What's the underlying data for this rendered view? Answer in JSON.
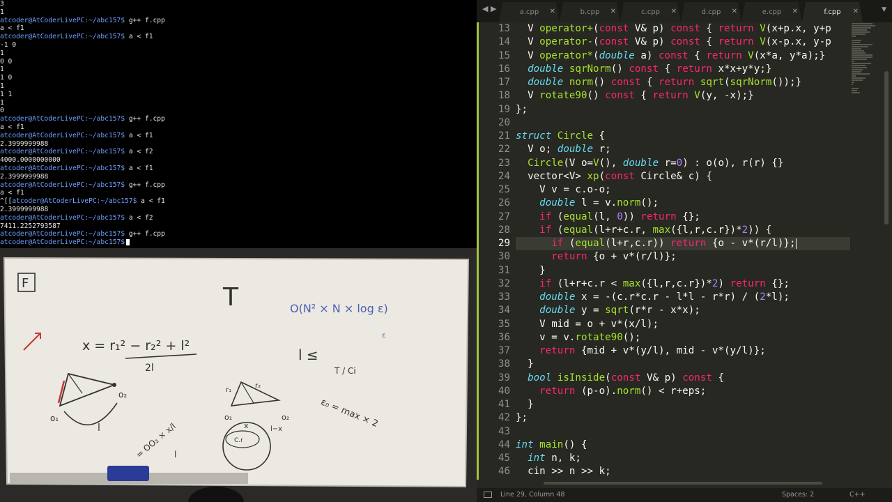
{
  "terminal": {
    "lines": [
      {
        "text": "3"
      },
      {
        "text": "1"
      },
      {
        "prompt": "atcoder@AtCoderLivePC:~/abc157$",
        "cmd": " g++ f.cpp"
      },
      {
        "text": "a < f1"
      },
      {
        "prompt": "atcoder@AtCoderLivePC:~/abc157$",
        "cmd": " a < f1"
      },
      {
        "text": "-1 0"
      },
      {
        "text": "1"
      },
      {
        "text": "0 0"
      },
      {
        "text": "1"
      },
      {
        "text": "1 0"
      },
      {
        "text": "1"
      },
      {
        "text": "1 1"
      },
      {
        "text": "1"
      },
      {
        "text": "0"
      },
      {
        "prompt": "atcoder@AtCoderLivePC:~/abc157$",
        "cmd": " g++ f.cpp"
      },
      {
        "text": "a < f1"
      },
      {
        "prompt": "atcoder@AtCoderLivePC:~/abc157$",
        "cmd": " a < f1"
      },
      {
        "text": "2.3999999988"
      },
      {
        "prompt": "atcoder@AtCoderLivePC:~/abc157$",
        "cmd": " a < f2"
      },
      {
        "text": "4000.0000000000"
      },
      {
        "prompt": "atcoder@AtCoderLivePC:~/abc157$",
        "cmd": " a < f1"
      },
      {
        "text": "2.3999999988"
      },
      {
        "prompt": "atcoder@AtCoderLivePC:~/abc157$",
        "cmd": " g++ f.cpp"
      },
      {
        "text": "a < f1"
      },
      {
        "prefix": "^[[",
        "prompt": "atcoder@AtCoderLivePC:~/abc157$",
        "cmd": " a < f1"
      },
      {
        "text": "2.3999999988"
      },
      {
        "prompt": "atcoder@AtCoderLivePC:~/abc157$",
        "cmd": " a < f2"
      },
      {
        "text": "7411.2252793587"
      },
      {
        "prompt": "atcoder@AtCoderLivePC:~/abc157$",
        "cmd": " g++ f.cpp"
      },
      {
        "prompt": "atcoder@AtCoderLivePC:~/abc157$",
        "cmd": "",
        "cursor": true
      }
    ]
  },
  "whiteboard": {
    "problem_label": "F",
    "t_label": "T",
    "complexity": "O(N² × N × log ε)",
    "formula_x": "x = r₁² − r₂² + l²",
    "formula_den": "2l",
    "inequality_l": "l ≤",
    "inequality_frac": "T / Ci",
    "eps_note": "ε",
    "label_o1": "o₁",
    "label_o2": "o₂",
    "label_l": "l",
    "label_r1": "r₁",
    "label_r2": "r₂",
    "label_x": "x",
    "label_lx": "l−x",
    "vec_note": "= OO₂ × x/l",
    "vec_note2": "l",
    "bin_note": "ε₀ = max × 2",
    "circle_label": "C.r"
  },
  "editor": {
    "nav": "◀ ▶",
    "tabs": [
      {
        "label": "a.cpp",
        "close": "✕",
        "active": false
      },
      {
        "label": "b.cpp",
        "close": "✕",
        "active": false
      },
      {
        "label": "c.cpp",
        "close": "✕",
        "active": false
      },
      {
        "label": "d.cpp",
        "close": "✕",
        "active": false
      },
      {
        "label": "e.cpp",
        "close": "✕",
        "active": false
      },
      {
        "label": "f.cpp",
        "close": "✕",
        "active": true
      }
    ],
    "overflow": "▼",
    "current_line": 29,
    "lines": [
      {
        "num": "13",
        "tokens": [
          [
            "  V ",
            ""
          ],
          [
            "operator+",
            "f"
          ],
          [
            "(",
            ""
          ],
          [
            "const",
            "k"
          ],
          [
            " V& p) ",
            ""
          ],
          [
            "const",
            "k"
          ],
          [
            " { ",
            ""
          ],
          [
            "return",
            "k"
          ],
          [
            " ",
            ""
          ],
          [
            "V",
            "f"
          ],
          [
            "(x+p.x, y+p",
            ""
          ]
        ]
      },
      {
        "num": "14",
        "tokens": [
          [
            "  V ",
            ""
          ],
          [
            "operator-",
            "f"
          ],
          [
            "(",
            ""
          ],
          [
            "const",
            "k"
          ],
          [
            " V& p) ",
            ""
          ],
          [
            "const",
            "k"
          ],
          [
            " { ",
            ""
          ],
          [
            "return",
            "k"
          ],
          [
            " ",
            ""
          ],
          [
            "V",
            "f"
          ],
          [
            "(x-p.x, y-p",
            ""
          ]
        ]
      },
      {
        "num": "15",
        "tokens": [
          [
            "  V ",
            ""
          ],
          [
            "operator*",
            "f"
          ],
          [
            "(",
            ""
          ],
          [
            "double",
            "t"
          ],
          [
            " a) ",
            ""
          ],
          [
            "const",
            "k"
          ],
          [
            " { ",
            ""
          ],
          [
            "return",
            "k"
          ],
          [
            " ",
            ""
          ],
          [
            "V",
            "f"
          ],
          [
            "(x*a, y*a);}",
            ""
          ]
        ]
      },
      {
        "num": "16",
        "tokens": [
          [
            "  ",
            ""
          ],
          [
            "double",
            "t"
          ],
          [
            " ",
            ""
          ],
          [
            "sqrNorm",
            "f"
          ],
          [
            "() ",
            ""
          ],
          [
            "const",
            "k"
          ],
          [
            " { ",
            ""
          ],
          [
            "return",
            "k"
          ],
          [
            " x*x+y*y;}",
            ""
          ]
        ]
      },
      {
        "num": "17",
        "tokens": [
          [
            "  ",
            ""
          ],
          [
            "double",
            "t"
          ],
          [
            " ",
            ""
          ],
          [
            "norm",
            "f"
          ],
          [
            "() ",
            ""
          ],
          [
            "const",
            "k"
          ],
          [
            " { ",
            ""
          ],
          [
            "return",
            "k"
          ],
          [
            " ",
            ""
          ],
          [
            "sqrt",
            "f"
          ],
          [
            "(",
            ""
          ],
          [
            "sqrNorm",
            "f"
          ],
          [
            "());}",
            ""
          ]
        ]
      },
      {
        "num": "18",
        "tokens": [
          [
            "  V ",
            ""
          ],
          [
            "rotate90",
            "f"
          ],
          [
            "() ",
            ""
          ],
          [
            "const",
            "k"
          ],
          [
            " { ",
            ""
          ],
          [
            "return",
            "k"
          ],
          [
            " ",
            ""
          ],
          [
            "V",
            "f"
          ],
          [
            "(y, -x);}",
            ""
          ]
        ]
      },
      {
        "num": "19",
        "tokens": [
          [
            "};",
            ""
          ]
        ]
      },
      {
        "num": "20",
        "tokens": [
          [
            "",
            ""
          ]
        ]
      },
      {
        "num": "21",
        "tokens": [
          [
            "struct",
            "t"
          ],
          [
            " ",
            ""
          ],
          [
            "Circle",
            "f"
          ],
          [
            " {",
            ""
          ]
        ]
      },
      {
        "num": "22",
        "tokens": [
          [
            "  V o; ",
            ""
          ],
          [
            "double",
            "t"
          ],
          [
            " r;",
            ""
          ]
        ]
      },
      {
        "num": "23",
        "tokens": [
          [
            "  ",
            ""
          ],
          [
            "Circle",
            "f"
          ],
          [
            "(V o=",
            ""
          ],
          [
            "V",
            "f"
          ],
          [
            "(), ",
            ""
          ],
          [
            "double",
            "t"
          ],
          [
            " r=",
            ""
          ],
          [
            "0",
            "n"
          ],
          [
            ") : o(o), r(r) {}",
            ""
          ]
        ]
      },
      {
        "num": "24",
        "tokens": [
          [
            "  vector<V> ",
            ""
          ],
          [
            "xp",
            "f"
          ],
          [
            "(",
            ""
          ],
          [
            "const",
            "k"
          ],
          [
            " Circle& c) {",
            ""
          ]
        ]
      },
      {
        "num": "25",
        "tokens": [
          [
            "    V v = c.o-o;",
            ""
          ]
        ]
      },
      {
        "num": "26",
        "tokens": [
          [
            "    ",
            ""
          ],
          [
            "double",
            "t"
          ],
          [
            " l = v.",
            ""
          ],
          [
            "norm",
            "f"
          ],
          [
            "();",
            ""
          ]
        ]
      },
      {
        "num": "27",
        "tokens": [
          [
            "    ",
            ""
          ],
          [
            "if",
            "k"
          ],
          [
            " (",
            ""
          ],
          [
            "equal",
            "f"
          ],
          [
            "(l, ",
            ""
          ],
          [
            "0",
            "n"
          ],
          [
            ")) ",
            ""
          ],
          [
            "return",
            "k"
          ],
          [
            " {};",
            ""
          ]
        ]
      },
      {
        "num": "28",
        "tokens": [
          [
            "    ",
            ""
          ],
          [
            "if",
            "k"
          ],
          [
            " (",
            ""
          ],
          [
            "equal",
            "f"
          ],
          [
            "(l+r+c.r, ",
            ""
          ],
          [
            "max",
            "f"
          ],
          [
            "({l,r,c.r})*",
            ""
          ],
          [
            "2",
            "n"
          ],
          [
            ")) {",
            ""
          ]
        ]
      },
      {
        "num": "29",
        "tokens": [
          [
            "      ",
            ""
          ],
          [
            "if",
            "k"
          ],
          [
            " (",
            ""
          ],
          [
            "equal",
            "f"
          ],
          [
            "(l+r,c.r)) ",
            ""
          ],
          [
            "return",
            "k"
          ],
          [
            " {o - v*(r/l)};",
            ""
          ]
        ],
        "caret": true
      },
      {
        "num": "30",
        "tokens": [
          [
            "      ",
            ""
          ],
          [
            "return",
            "k"
          ],
          [
            " {o + v*(r/l)};",
            ""
          ]
        ]
      },
      {
        "num": "31",
        "tokens": [
          [
            "    }",
            ""
          ]
        ]
      },
      {
        "num": "32",
        "tokens": [
          [
            "    ",
            ""
          ],
          [
            "if",
            "k"
          ],
          [
            " (l+r+c.r < ",
            ""
          ],
          [
            "max",
            "f"
          ],
          [
            "({l,r,c.r})*",
            ""
          ],
          [
            "2",
            "n"
          ],
          [
            ") ",
            ""
          ],
          [
            "return",
            "k"
          ],
          [
            " {};",
            ""
          ]
        ]
      },
      {
        "num": "33",
        "tokens": [
          [
            "    ",
            ""
          ],
          [
            "double",
            "t"
          ],
          [
            " x = -(c.r*c.r - l*l - r*r) / (",
            ""
          ],
          [
            "2",
            "n"
          ],
          [
            "*l);",
            ""
          ]
        ]
      },
      {
        "num": "34",
        "tokens": [
          [
            "    ",
            ""
          ],
          [
            "double",
            "t"
          ],
          [
            " y = ",
            ""
          ],
          [
            "sqrt",
            "f"
          ],
          [
            "(r*r - x*x);",
            ""
          ]
        ]
      },
      {
        "num": "35",
        "tokens": [
          [
            "    V mid = o + v*(x/l);",
            ""
          ]
        ]
      },
      {
        "num": "36",
        "tokens": [
          [
            "    v = v.",
            ""
          ],
          [
            "rotate90",
            "f"
          ],
          [
            "();",
            ""
          ]
        ]
      },
      {
        "num": "37",
        "tokens": [
          [
            "    ",
            ""
          ],
          [
            "return",
            "k"
          ],
          [
            " {mid + v*(y/l), mid - v*(y/l)};",
            ""
          ]
        ]
      },
      {
        "num": "38",
        "tokens": [
          [
            "  }",
            ""
          ]
        ]
      },
      {
        "num": "39",
        "tokens": [
          [
            "  ",
            ""
          ],
          [
            "bool",
            "t"
          ],
          [
            " ",
            ""
          ],
          [
            "isInside",
            "f"
          ],
          [
            "(",
            ""
          ],
          [
            "const",
            "k"
          ],
          [
            " V& p) ",
            ""
          ],
          [
            "const",
            "k"
          ],
          [
            " {",
            ""
          ]
        ]
      },
      {
        "num": "40",
        "tokens": [
          [
            "    ",
            ""
          ],
          [
            "return",
            "k"
          ],
          [
            " (p-o).",
            ""
          ],
          [
            "norm",
            "f"
          ],
          [
            "() < r+eps;",
            ""
          ]
        ]
      },
      {
        "num": "41",
        "tokens": [
          [
            "  }",
            ""
          ]
        ]
      },
      {
        "num": "42",
        "tokens": [
          [
            "};",
            ""
          ]
        ]
      },
      {
        "num": "43",
        "tokens": [
          [
            "",
            ""
          ]
        ]
      },
      {
        "num": "44",
        "tokens": [
          [
            "int",
            "t"
          ],
          [
            " ",
            ""
          ],
          [
            "main",
            "f"
          ],
          [
            "() {",
            ""
          ]
        ]
      },
      {
        "num": "45",
        "tokens": [
          [
            "  ",
            ""
          ],
          [
            "int",
            "t"
          ],
          [
            " n, k;",
            ""
          ]
        ]
      },
      {
        "num": "46",
        "tokens": [
          [
            "  cin >> n >> k;",
            ""
          ]
        ]
      }
    ],
    "status": {
      "position": "Line 29, Column 48",
      "spaces": "Spaces: 2",
      "language": "C++"
    }
  },
  "colors": {
    "keyword": "#f92672",
    "type": "#66d9ef",
    "function": "#a6e22e",
    "number": "#ae81ff",
    "accent": "#9fc23c",
    "prompt": "#6ea0ff"
  }
}
